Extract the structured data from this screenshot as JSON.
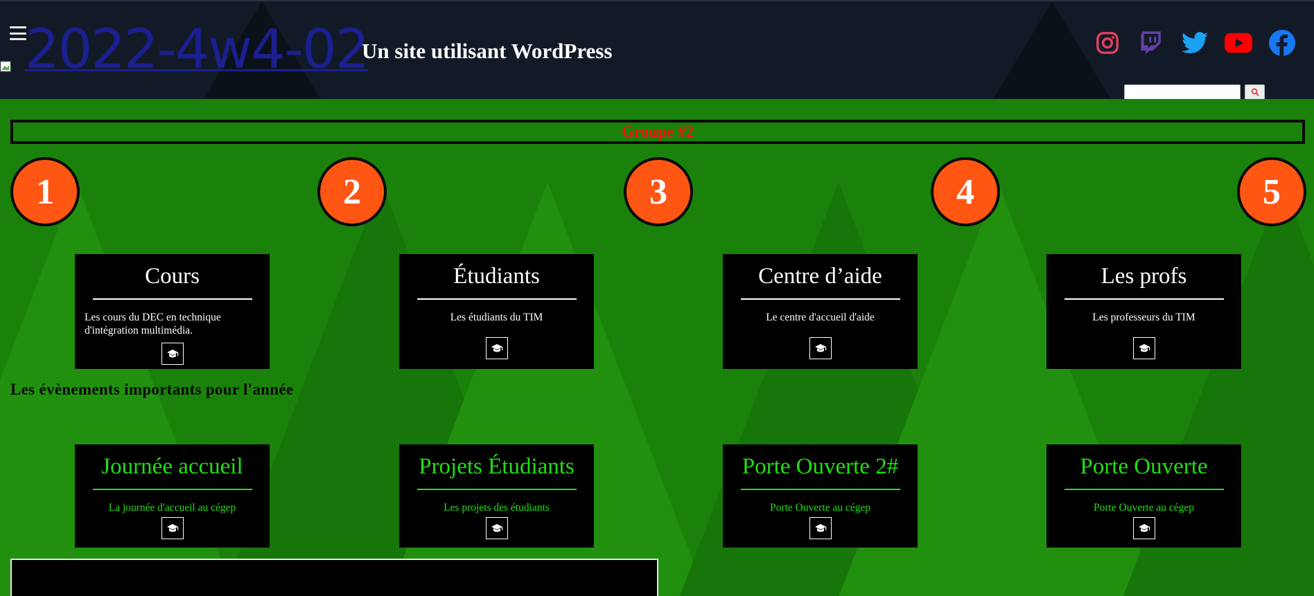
{
  "header": {
    "site_title": "2022-4w4-02",
    "tagline": "Un site utilisant WordPress",
    "social": [
      {
        "name": "instagram-icon",
        "color": "#e4405f"
      },
      {
        "name": "twitch-icon",
        "color": "#6441a5"
      },
      {
        "name": "twitter-icon",
        "color": "#1da1f2"
      },
      {
        "name": "youtube-icon",
        "color": "#ff0000"
      },
      {
        "name": "facebook-icon",
        "color": "#1877f2"
      }
    ],
    "search": {
      "value": "",
      "button_icon": "search-icon"
    }
  },
  "main": {
    "group_banner": "Groupe #2",
    "steps": [
      "1",
      "2",
      "3",
      "4",
      "5"
    ],
    "cards": [
      {
        "title": "Cours",
        "desc": "Les cours du DEC en technique d'intégration multimédia.",
        "icon": "graduation-cap-icon"
      },
      {
        "title": "Étudiants",
        "desc": "Les étudiants du TIM",
        "icon": "graduation-cap-icon"
      },
      {
        "title": "Centre d’aide",
        "desc": "Le centre d'accueil d'aide",
        "icon": "graduation-cap-icon"
      },
      {
        "title": "Les profs",
        "desc": "Les professeurs du TIM",
        "icon": "graduation-cap-icon"
      }
    ],
    "events_heading": "Les évènements importants pour l'année",
    "events": [
      {
        "title": "Journée accueil",
        "desc": "La journée d'accueil au cégep",
        "icon": "graduation-cap-icon"
      },
      {
        "title": "Projets Étudiants",
        "desc": "Les projets des étudiants",
        "icon": "graduation-cap-icon"
      },
      {
        "title": "Porte Ouverte 2#",
        "desc": "Porte Ouverte au cégep",
        "icon": "graduation-cap-icon"
      },
      {
        "title": "Porte Ouverte",
        "desc": "Porte Ouverte au cégep",
        "icon": "graduation-cap-icon"
      }
    ]
  },
  "colors": {
    "header_bg": "#121a27",
    "main_bg": "#1a820b",
    "circle": "#ff5614",
    "banner_text": "#ff0d0d",
    "event_text": "#20e010",
    "title_link": "#1b1f8f"
  }
}
